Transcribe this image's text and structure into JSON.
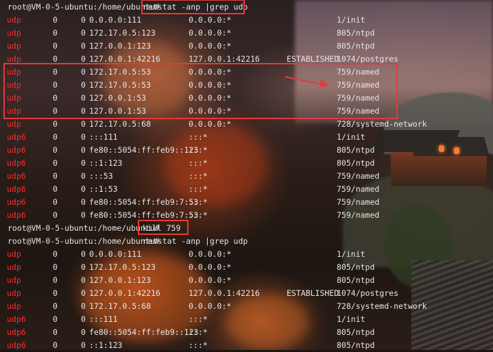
{
  "terminal": {
    "blocks": [
      {
        "prompt": "root@VM-0-5-ubuntu:/home/ubuntu#",
        "command": "netstat -anp |grep udp",
        "rows": [
          {
            "proto": "udp",
            "recv": "0",
            "send": "0",
            "local": "0.0.0.0:111",
            "foreign": "0.0.0.0:*",
            "state": "",
            "pid": "1/init"
          },
          {
            "proto": "udp",
            "recv": "0",
            "send": "0",
            "local": "172.17.0.5:123",
            "foreign": "0.0.0.0:*",
            "state": "",
            "pid": "805/ntpd"
          },
          {
            "proto": "udp",
            "recv": "0",
            "send": "0",
            "local": "127.0.0.1:123",
            "foreign": "0.0.0.0:*",
            "state": "",
            "pid": "805/ntpd"
          },
          {
            "proto": "udp",
            "recv": "0",
            "send": "0",
            "local": "127.0.0.1:42216",
            "foreign": "127.0.0.1:42216",
            "state": "ESTABLISHED",
            "pid": "1074/postgres"
          },
          {
            "proto": "udp",
            "recv": "0",
            "send": "0",
            "local": "172.17.0.5:53",
            "foreign": "0.0.0.0:*",
            "state": "",
            "pid": "759/named"
          },
          {
            "proto": "udp",
            "recv": "0",
            "send": "0",
            "local": "172.17.0.5:53",
            "foreign": "0.0.0.0:*",
            "state": "",
            "pid": "759/named"
          },
          {
            "proto": "udp",
            "recv": "0",
            "send": "0",
            "local": "127.0.0.1:53",
            "foreign": "0.0.0.0:*",
            "state": "",
            "pid": "759/named"
          },
          {
            "proto": "udp",
            "recv": "0",
            "send": "0",
            "local": "127.0.0.1:53",
            "foreign": "0.0.0.0:*",
            "state": "",
            "pid": "759/named"
          },
          {
            "proto": "udp",
            "recv": "0",
            "send": "0",
            "local": "172.17.0.5:68",
            "foreign": "0.0.0.0:*",
            "state": "",
            "pid": "728/systemd-network"
          },
          {
            "proto": "udp6",
            "recv": "0",
            "send": "0",
            "local": ":::111",
            "foreign": ":::*",
            "state": "",
            "pid": "1/init"
          },
          {
            "proto": "udp6",
            "recv": "0",
            "send": "0",
            "local": "fe80::5054:ff:feb9::123",
            "foreign": ":::*",
            "state": "",
            "pid": "805/ntpd"
          },
          {
            "proto": "udp6",
            "recv": "0",
            "send": "0",
            "local": "::1:123",
            "foreign": ":::*",
            "state": "",
            "pid": "805/ntpd"
          },
          {
            "proto": "udp6",
            "recv": "0",
            "send": "0",
            "local": ":::53",
            "foreign": ":::*",
            "state": "",
            "pid": "759/named"
          },
          {
            "proto": "udp6",
            "recv": "0",
            "send": "0",
            "local": "::1:53",
            "foreign": ":::*",
            "state": "",
            "pid": "759/named"
          },
          {
            "proto": "udp6",
            "recv": "0",
            "send": "0",
            "local": "fe80::5054:ff:feb9:7:53",
            "foreign": ":::*",
            "state": "",
            "pid": "759/named"
          },
          {
            "proto": "udp6",
            "recv": "0",
            "send": "0",
            "local": "fe80::5054:ff:feb9:7:53",
            "foreign": ":::*",
            "state": "",
            "pid": "759/named"
          }
        ]
      },
      {
        "prompt": "root@VM-0-5-ubuntu:/home/ubuntu#",
        "command": "kill 759",
        "rows": []
      },
      {
        "prompt": "root@VM-0-5-ubuntu:/home/ubuntu#",
        "command": "netstat -anp |grep udp",
        "rows": [
          {
            "proto": "udp",
            "recv": "0",
            "send": "0",
            "local": "0.0.0.0:111",
            "foreign": "0.0.0.0:*",
            "state": "",
            "pid": "1/init"
          },
          {
            "proto": "udp",
            "recv": "0",
            "send": "0",
            "local": "172.17.0.5:123",
            "foreign": "0.0.0.0:*",
            "state": "",
            "pid": "805/ntpd"
          },
          {
            "proto": "udp",
            "recv": "0",
            "send": "0",
            "local": "127.0.0.1:123",
            "foreign": "0.0.0.0:*",
            "state": "",
            "pid": "805/ntpd"
          },
          {
            "proto": "udp",
            "recv": "0",
            "send": "0",
            "local": "127.0.0.1:42216",
            "foreign": "127.0.0.1:42216",
            "state": "ESTABLISHED",
            "pid": "1074/postgres"
          },
          {
            "proto": "udp",
            "recv": "0",
            "send": "0",
            "local": "172.17.0.5:68",
            "foreign": "0.0.0.0:*",
            "state": "",
            "pid": "728/systemd-network"
          },
          {
            "proto": "udp6",
            "recv": "0",
            "send": "0",
            "local": ":::111",
            "foreign": ":::*",
            "state": "",
            "pid": "1/init"
          },
          {
            "proto": "udp6",
            "recv": "0",
            "send": "0",
            "local": "fe80::5054:ff:feb9::123",
            "foreign": ":::*",
            "state": "",
            "pid": "805/ntpd"
          },
          {
            "proto": "udp6",
            "recv": "0",
            "send": "0",
            "local": "::1:123",
            "foreign": ":::*",
            "state": "",
            "pid": "805/ntpd"
          }
        ]
      }
    ],
    "colors": {
      "protocol": "#ff2b2b",
      "text": "#e6e6e6",
      "annotation": "#e53a3a"
    },
    "annotations": [
      {
        "type": "highlight-box",
        "target": "first netstat command"
      },
      {
        "type": "highlight-box",
        "target": "named port 53 rows"
      },
      {
        "type": "arrow-icon",
        "target": "759/named"
      },
      {
        "type": "highlight-box",
        "target": "kill 759 command"
      }
    ]
  }
}
